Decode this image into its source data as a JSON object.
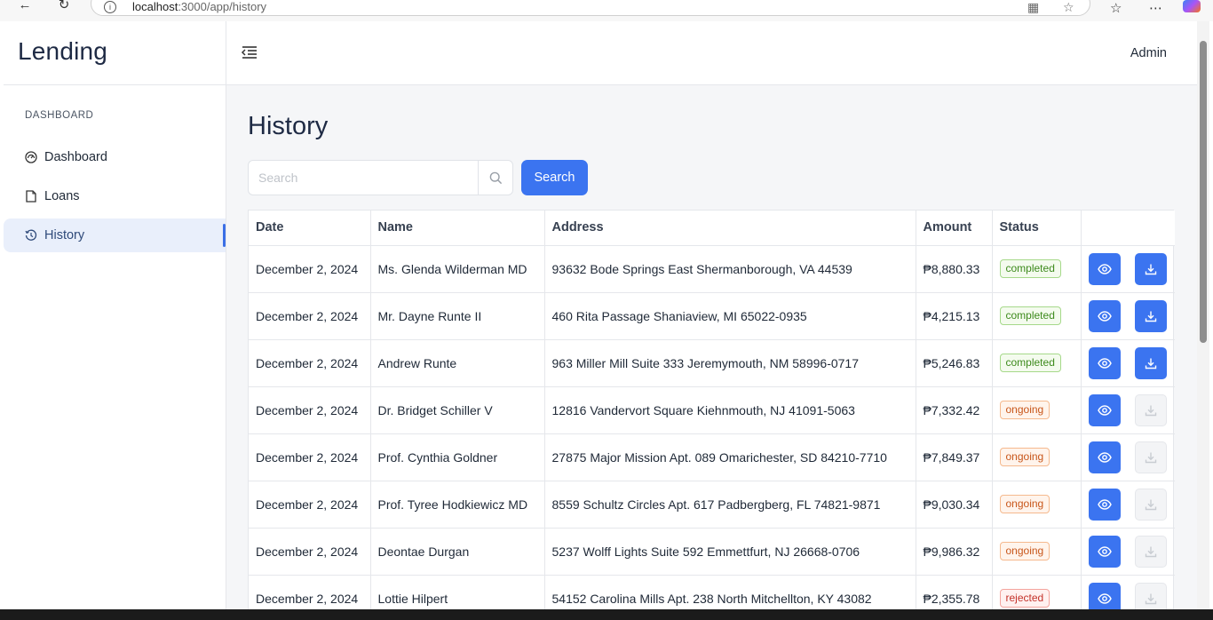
{
  "browser": {
    "url_host": "localhost",
    "url_path": ":3000/app/history"
  },
  "sidebar": {
    "brand": "Lending",
    "section_label": "DASHBOARD",
    "items": [
      {
        "label": "Dashboard",
        "icon": "gauge-icon"
      },
      {
        "label": "Loans",
        "icon": "document-icon"
      },
      {
        "label": "History",
        "icon": "history-icon",
        "active": true
      }
    ]
  },
  "header": {
    "user": "Admin"
  },
  "main": {
    "title": "History",
    "search": {
      "placeholder": "Search",
      "button_label": "Search"
    },
    "table": {
      "columns": [
        "Date",
        "Name",
        "Address",
        "Amount",
        "Status",
        ""
      ],
      "rows": [
        {
          "date": "December 2, 2024",
          "name": "Ms. Glenda Wilderman MD",
          "address": "93632 Bode Springs East Shermanborough, VA 44539",
          "amount": "₱8,880.33",
          "status": "completed"
        },
        {
          "date": "December 2, 2024",
          "name": "Mr. Dayne Runte II",
          "address": "460 Rita Passage Shaniaview, MI 65022-0935",
          "amount": "₱4,215.13",
          "status": "completed"
        },
        {
          "date": "December 2, 2024",
          "name": "Andrew Runte",
          "address": "963 Miller Mill Suite 333 Jeremymouth, NM 58996-0717",
          "amount": "₱5,246.83",
          "status": "completed"
        },
        {
          "date": "December 2, 2024",
          "name": "Dr. Bridget Schiller V",
          "address": "12816 Vandervort Square Kiehnmouth, NJ 41091-5063",
          "amount": "₱7,332.42",
          "status": "ongoing"
        },
        {
          "date": "December 2, 2024",
          "name": "Prof. Cynthia Goldner",
          "address": "27875 Major Mission Apt. 089 Omarichester, SD 84210-7710",
          "amount": "₱7,849.37",
          "status": "ongoing"
        },
        {
          "date": "December 2, 2024",
          "name": "Prof. Tyree Hodkiewicz MD",
          "address": "8559 Schultz Circles Apt. 617 Padbergberg, FL 74821-9871",
          "amount": "₱9,030.34",
          "status": "ongoing"
        },
        {
          "date": "December 2, 2024",
          "name": "Deontae Durgan",
          "address": "5237 Wolff Lights Suite 592 Emmettfurt, NJ 26668-0706",
          "amount": "₱9,986.32",
          "status": "ongoing"
        },
        {
          "date": "December 2, 2024",
          "name": "Lottie Hilpert",
          "address": "54152 Carolina Mills Apt. 238 North Mitchellton, KY 43082",
          "amount": "₱2,355.78",
          "status": "rejected"
        }
      ]
    }
  },
  "colors": {
    "primary": "#3b74f0",
    "completed": "#3d8a1c",
    "ongoing": "#c8561a",
    "rejected": "#c4322a"
  }
}
